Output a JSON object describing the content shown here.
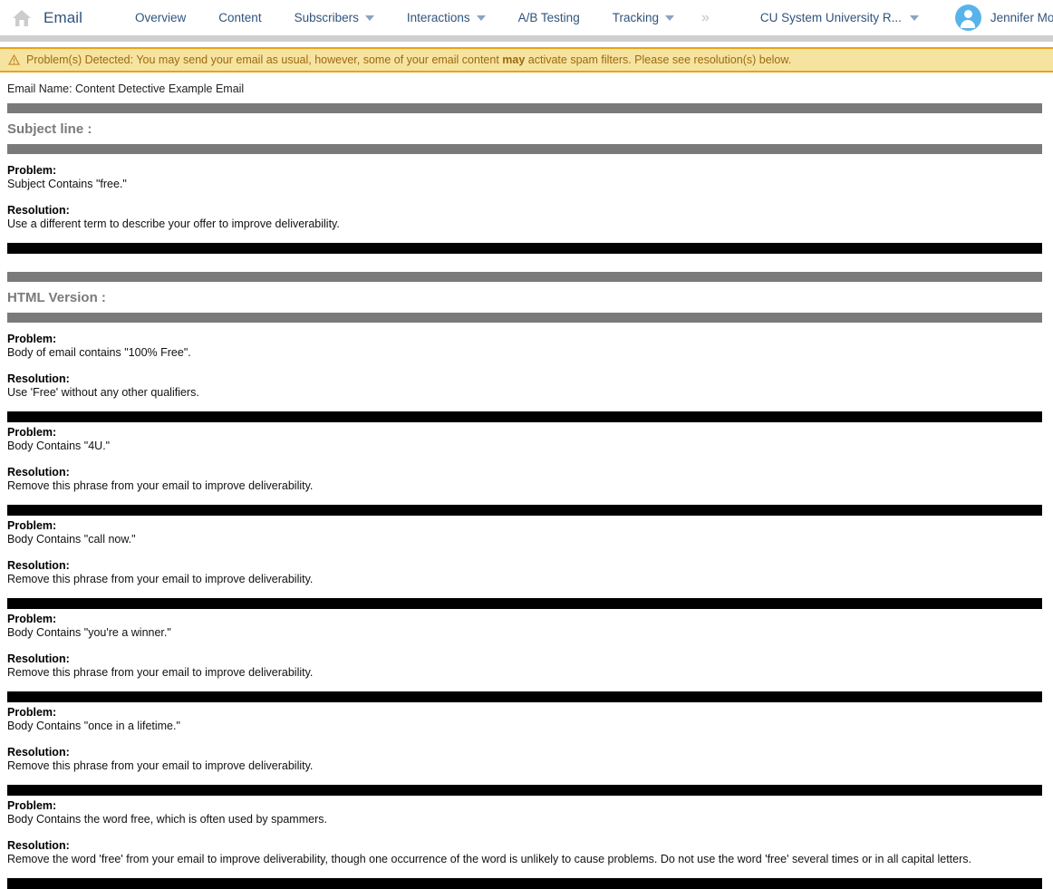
{
  "header": {
    "home_icon": "home-icon",
    "brand": "Email",
    "nav": [
      {
        "label": "Overview",
        "has_caret": false
      },
      {
        "label": "Content",
        "has_caret": false
      },
      {
        "label": "Subscribers",
        "has_caret": true
      },
      {
        "label": "Interactions",
        "has_caret": true
      },
      {
        "label": "A/B Testing",
        "has_caret": false
      },
      {
        "label": "Tracking",
        "has_caret": true
      }
    ],
    "overflow_glyph": "»",
    "account": "CU System University R...",
    "user": "Jennifer Mortensen",
    "nav_color": "#30537d",
    "avatar_color": "#57b4ea"
  },
  "alert": {
    "icon": "warning-triangle-icon",
    "text_before": "Problem(s) Detected: You may send your email as usual, however, some of your email content ",
    "emphasis": "may",
    "text_after": " activate spam filters. Please see resolution(s) below.",
    "bg": "#f6e3a0",
    "border": "#e8a317",
    "text_color": "#9c6a10"
  },
  "content": {
    "email_name": "Email Name: Content Detective Example Email",
    "problem_label": "Problem:",
    "resolution_label": "Resolution:",
    "sections": [
      {
        "title": "Subject line :",
        "issues": [
          {
            "problem": "Subject Contains \"free.\"",
            "resolution": "Use a different term to describe your offer to improve deliverability."
          }
        ]
      },
      {
        "title": "HTML Version :",
        "issues": [
          {
            "problem": "Body of email contains \"100% Free\".",
            "resolution": "Use 'Free' without any other qualifiers."
          },
          {
            "problem": "Body Contains \"4U.\"",
            "resolution": "Remove this phrase from your email to improve deliverability."
          },
          {
            "problem": "Body Contains \"call now.\"",
            "resolution": "Remove this phrase from your email to improve deliverability."
          },
          {
            "problem": "Body Contains \"you're a winner.\"",
            "resolution": "Remove this phrase from your email to improve deliverability."
          },
          {
            "problem": "Body Contains \"once in a lifetime.\"",
            "resolution": "Remove this phrase from your email to improve deliverability."
          },
          {
            "problem": "Body Contains the word free, which is often used by spammers.",
            "resolution": "Remove the word 'free' from your email to improve deliverability, though one occurrence of the word is unlikely to cause problems. Do not use the word 'free' several times or in all capital letters."
          }
        ]
      }
    ]
  }
}
